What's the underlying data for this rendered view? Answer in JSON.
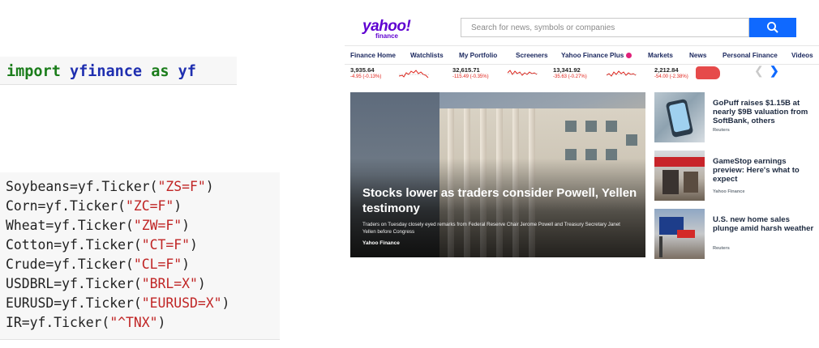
{
  "code": {
    "import_line": {
      "kw1": "import",
      "module": "yfinance",
      "kw2": "as",
      "alias": "yf"
    },
    "tickers": [
      {
        "var": "Soybeans",
        "symbol": "\"ZS=F\""
      },
      {
        "var": "Corn",
        "symbol": "\"ZC=F\""
      },
      {
        "var": "Wheat",
        "symbol": "\"ZW=F\""
      },
      {
        "var": "Cotton",
        "symbol": "\"CT=F\""
      },
      {
        "var": "Crude",
        "symbol": "\"CL=F\""
      },
      {
        "var": "USDBRL",
        "symbol": "\"BRL=X\""
      },
      {
        "var": "EURUSD",
        "symbol": "\"EURUSD=X\""
      },
      {
        "var": "IR",
        "symbol": "\"^TNX\""
      }
    ],
    "call_prefix": "=yf.Ticker(",
    "call_suffix": ")"
  },
  "yahoo": {
    "logo": {
      "brand": "yahoo!",
      "sub": "finance",
      "color": "#5f01d1"
    },
    "search": {
      "placeholder": "Search for news, symbols or companies",
      "button_icon": "search-icon"
    },
    "nav": [
      "Finance Home",
      "Watchlists",
      "My Portfolio",
      "Screeners",
      "Yahoo Finance Plus",
      "Markets",
      "News",
      "Personal Finance",
      "Videos"
    ],
    "quotes": [
      {
        "price": "3,935.64",
        "change": "-4.95 (-0.13%)"
      },
      {
        "price": "32,615.71",
        "change": "-115.49 (-0.35%)"
      },
      {
        "price": "13,341.92",
        "change": "-35.63 (-0.27%)"
      },
      {
        "price": "2,212.84",
        "change": "-54.00 (-2.38%)"
      }
    ],
    "hero": {
      "title": "Stocks lower as traders consider Powell, Yellen testimony",
      "description": "Traders on Tuesday closely eyed remarks from Federal Reserve Chair Jerome Powell and Treasury Secretary Janet Yellen before Congress",
      "source": "Yahoo Finance"
    },
    "stories": [
      {
        "title": "GoPuff raises $1.15B at nearly $9B valuation from SoftBank, others",
        "source": "Reuters"
      },
      {
        "title": "GameStop earnings preview: Here's what to expect",
        "source": "Yahoo Finance"
      },
      {
        "title": "U.S. new home sales plunge amid harsh weather",
        "source": "Reuters"
      }
    ],
    "colors": {
      "accent": "#0f69ff",
      "negative": "#e0231b",
      "nav_text": "#1d2a60"
    }
  }
}
